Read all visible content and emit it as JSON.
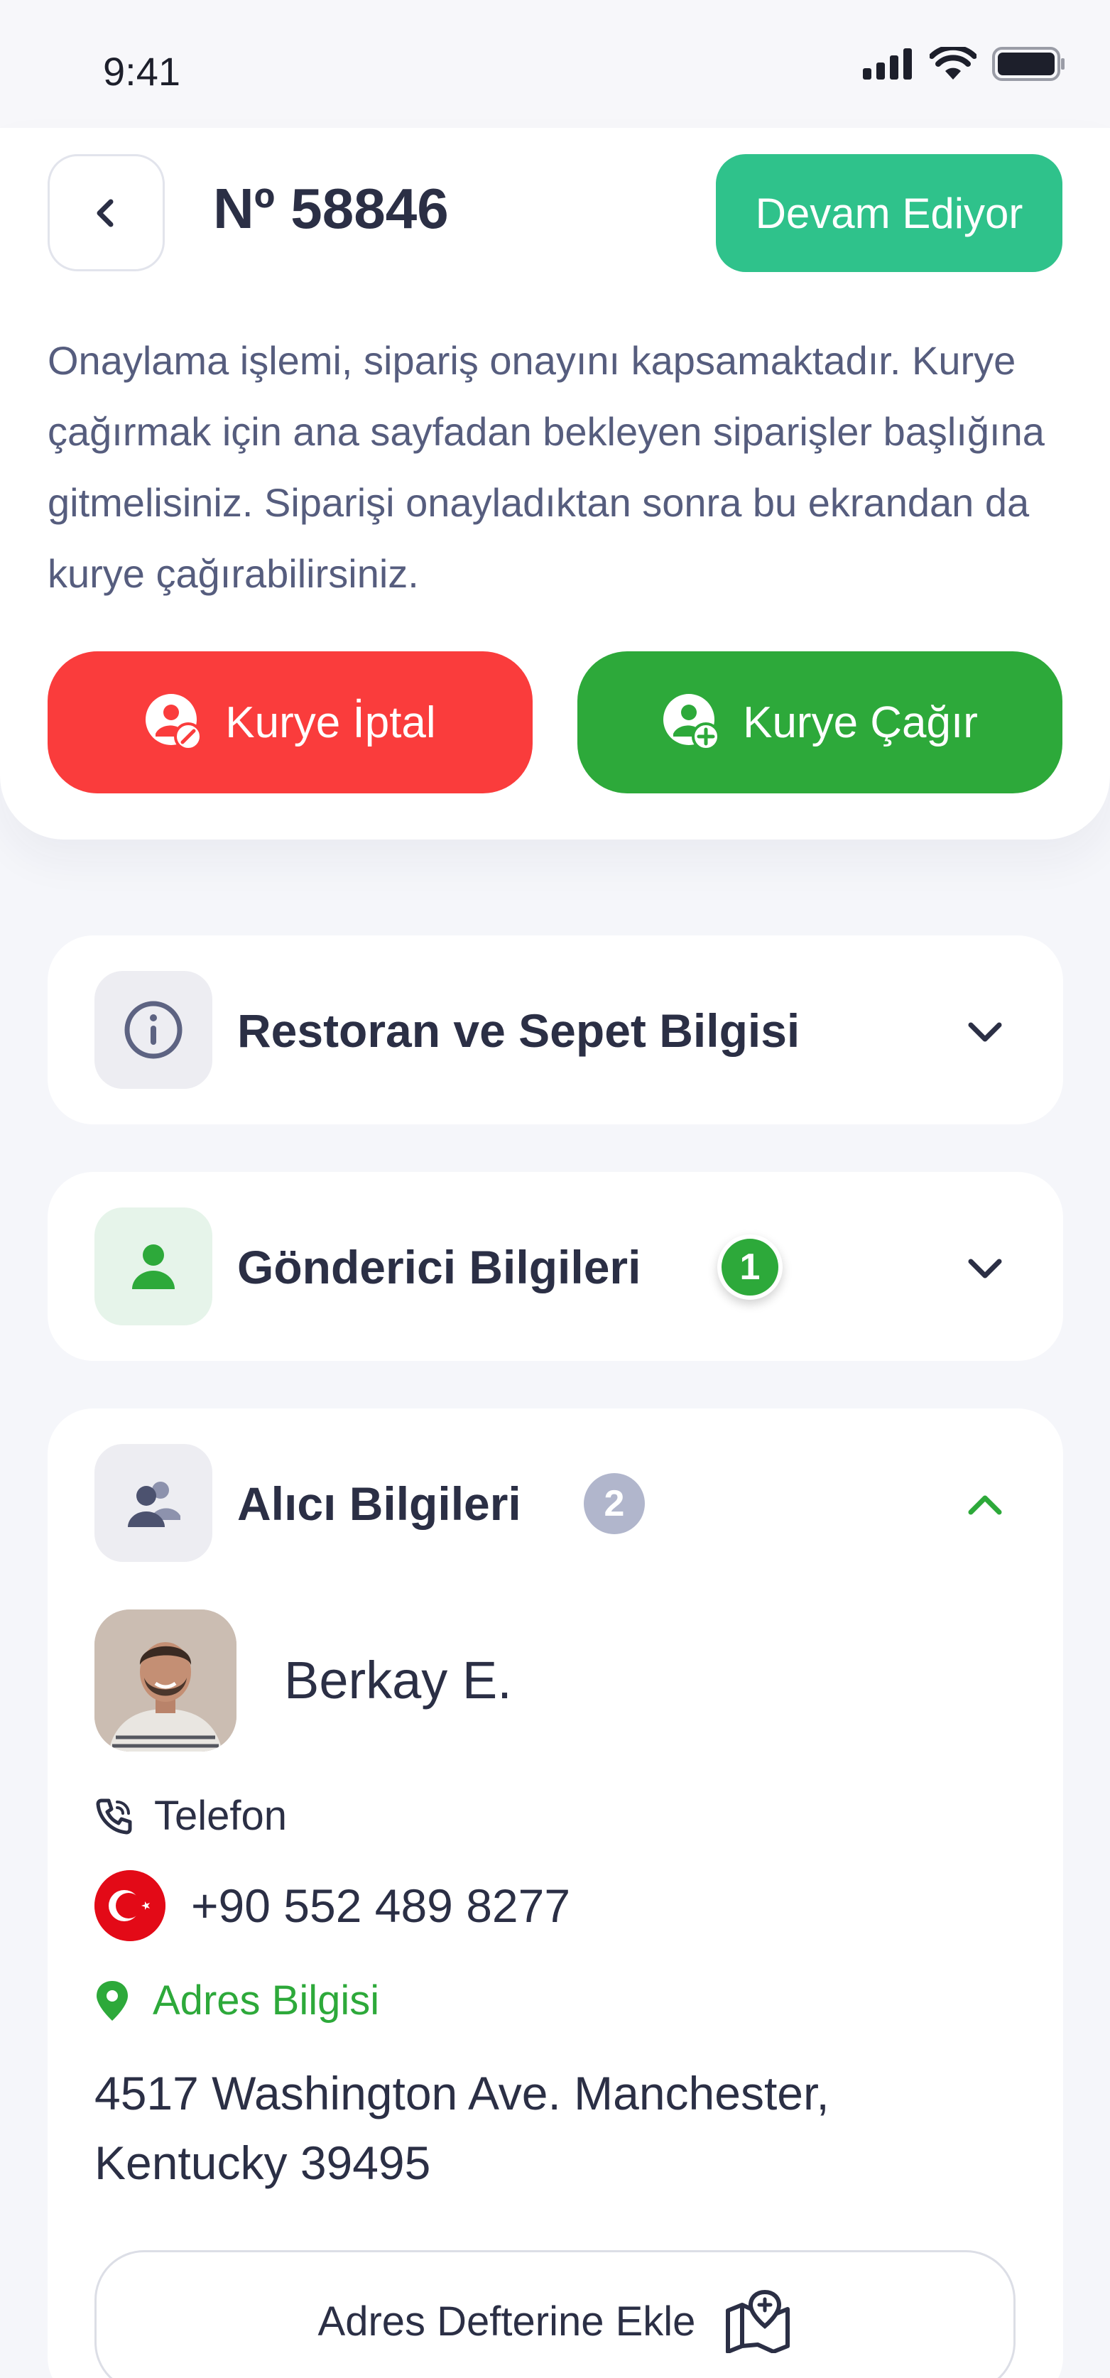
{
  "status_bar": {
    "time": "9:41"
  },
  "header": {
    "order_number": "Nº 58846",
    "status_label": "Devam Ediyor",
    "info_text": "Onaylama işlemi, sipariş onayını kapsamaktadır. Kurye çağırmak için ana sayfadan bekleyen siparişler başlığına gitmelisiniz. Siparişi onayladıktan sonra bu ekrandan da kurye çağırabilirsiniz."
  },
  "actions": {
    "cancel_label": "Kurye İptal",
    "call_label": "Kurye Çağır"
  },
  "sections": {
    "restaurant": {
      "title": "Restoran ve Sepet Bilgisi",
      "icon": "info-icon"
    },
    "sender": {
      "title": "Gönderici Bilgileri",
      "count": "1",
      "icon": "person-icon"
    },
    "receiver": {
      "title": "Alıcı Bilgileri",
      "count": "2",
      "icon": "people-icon"
    }
  },
  "receiver": {
    "name": "Berkay E.",
    "phone_label": "Telefon",
    "phone_number": "+90 552 489 8277",
    "address_label": "Adres Bilgisi",
    "address": "4517 Washington Ave. Manchester, Kentucky 39495",
    "address_book_label": "Adres Defterine Ekle"
  },
  "colors": {
    "status_green": "#2fc28b",
    "cancel_red": "#fa3c3c",
    "call_green": "#2da93a",
    "text_dark": "#2b2f45",
    "text_muted": "#565d7e"
  }
}
